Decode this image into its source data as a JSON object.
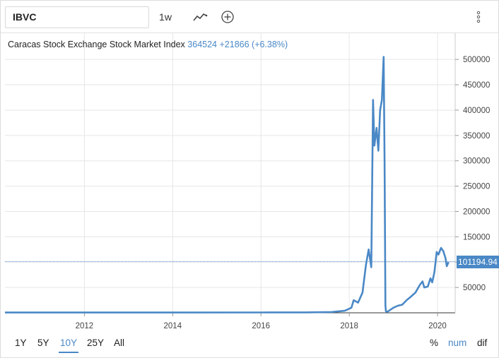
{
  "toolbar": {
    "symbol": "IBVC",
    "interval": "1w",
    "indicator_icon": "line-chart-icon",
    "add_icon": "plus-circle-icon",
    "more_icon": "vertical-dots-icon"
  },
  "legend": {
    "name": "Caracas Stock Exchange Stock Market Index",
    "last": "364524",
    "change": "+21866",
    "change_pct": "(+6.38%)"
  },
  "price_tag": "101194.94",
  "range": {
    "options": [
      "1Y",
      "5Y",
      "10Y",
      "25Y",
      "All"
    ],
    "active": "10Y"
  },
  "scale": {
    "options": [
      "%",
      "num",
      "dif"
    ],
    "active": "num"
  },
  "colors": {
    "accent": "#4a88c6",
    "grid": "#e6e6e6"
  },
  "chart_data": {
    "type": "line",
    "xlabel": "",
    "ylabel": "",
    "x_ticks": [
      "2012",
      "2014",
      "2016",
      "2018",
      "2020"
    ],
    "y_ticks": [
      "50000",
      "100000",
      "150000",
      "200000",
      "250000",
      "300000",
      "350000",
      "400000",
      "450000",
      "500000"
    ],
    "xlim": [
      2010.2,
      2020.4
    ],
    "ylim": [
      0,
      510000
    ],
    "current_value": 101194.94,
    "series": [
      {
        "x": [
          2010.2,
          2014.0,
          2016.0,
          2017.0,
          2017.6,
          2017.9,
          2018.05,
          2018.1,
          2018.2,
          2018.3,
          2018.38,
          2018.44,
          2018.5,
          2018.54,
          2018.57,
          2018.62,
          2018.66,
          2018.7,
          2018.74,
          2018.78,
          2018.8,
          2018.82,
          2018.83,
          2018.86,
          2018.9,
          2019.0,
          2019.1,
          2019.2,
          2019.3,
          2019.4,
          2019.5,
          2019.6,
          2019.66,
          2019.7,
          2019.78,
          2019.84,
          2019.88,
          2019.93,
          2019.98,
          2020.02,
          2020.08,
          2020.13,
          2020.18,
          2020.21,
          2020.25
        ],
        "y": [
          600,
          600,
          700,
          900,
          1500,
          4000,
          10000,
          25000,
          20000,
          40000,
          95000,
          125000,
          90000,
          420000,
          330000,
          365000,
          320000,
          400000,
          420000,
          505000,
          300000,
          15000,
          3000,
          2000,
          4000,
          10000,
          14000,
          16000,
          25000,
          32000,
          40000,
          55000,
          62000,
          50000,
          52000,
          68000,
          60000,
          80000,
          120000,
          115000,
          128000,
          122000,
          108000,
          92000,
          100000
        ]
      }
    ]
  }
}
